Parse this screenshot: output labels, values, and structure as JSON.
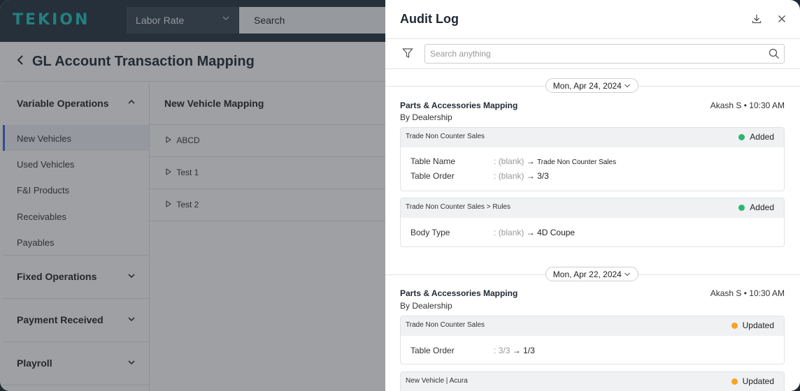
{
  "app": {
    "logo": "TEKION",
    "labor_select": "Labor Rate",
    "search": "Search",
    "page_title": "GL Account Transaction Mapping"
  },
  "sidebar": {
    "variable_operations": "Variable Operations",
    "items": [
      "New Vehicles",
      "Used Vehicles",
      "F&I Products",
      "Receivables",
      "Payables"
    ],
    "fixed_operations": "Fixed Operations",
    "payment_received": "Payment Received",
    "playroll": "Playroll"
  },
  "mapping": {
    "header": "New Vehicle Mapping",
    "rows": [
      "ABCD",
      "Test 1",
      "Test 2"
    ]
  },
  "audit": {
    "title": "Audit Log",
    "search_placeholder": "Search anything",
    "groups": [
      {
        "date": "Mon, Apr 24, 2024",
        "entry_title": "Parts & Accessories Mapping",
        "entry_sub": "By Dealership",
        "meta": "Akash S • 10:30 AM",
        "cards": [
          {
            "header": "Trade Non Counter Sales",
            "status": "Added",
            "status_color": "#2bb673",
            "fields": [
              {
                "label": "Table Name",
                "old": "(blank)",
                "new": "Trade Non Counter Sales"
              },
              {
                "label": "Table Order",
                "old": "(blank)",
                "new": "3/3"
              }
            ]
          },
          {
            "header": "Trade Non Counter Sales > Rules",
            "status": "Added",
            "status_color": "#2bb673",
            "fields": [
              {
                "label": "Body Type",
                "old": "(blank)",
                "new": "4D Coupe"
              }
            ]
          }
        ]
      },
      {
        "date": "Mon, Apr 22, 2024",
        "entry_title": "Parts & Accessories Mapping",
        "entry_sub": "By Dealership",
        "meta": "Akash S • 10:30 AM",
        "cards": [
          {
            "header": "Trade Non Counter Sales",
            "status": "Updated",
            "status_color": "#f5a623",
            "fields": [
              {
                "label": "Table Order",
                "old": "3/3",
                "new": "1/3"
              }
            ]
          },
          {
            "header": "New Vehicle | Acura",
            "status": "Updated",
            "status_color": "#f5a623",
            "fields": []
          }
        ]
      }
    ]
  },
  "symbols": {
    "arrow": "→",
    "colon": ":",
    "chevron_down": "⌵"
  }
}
